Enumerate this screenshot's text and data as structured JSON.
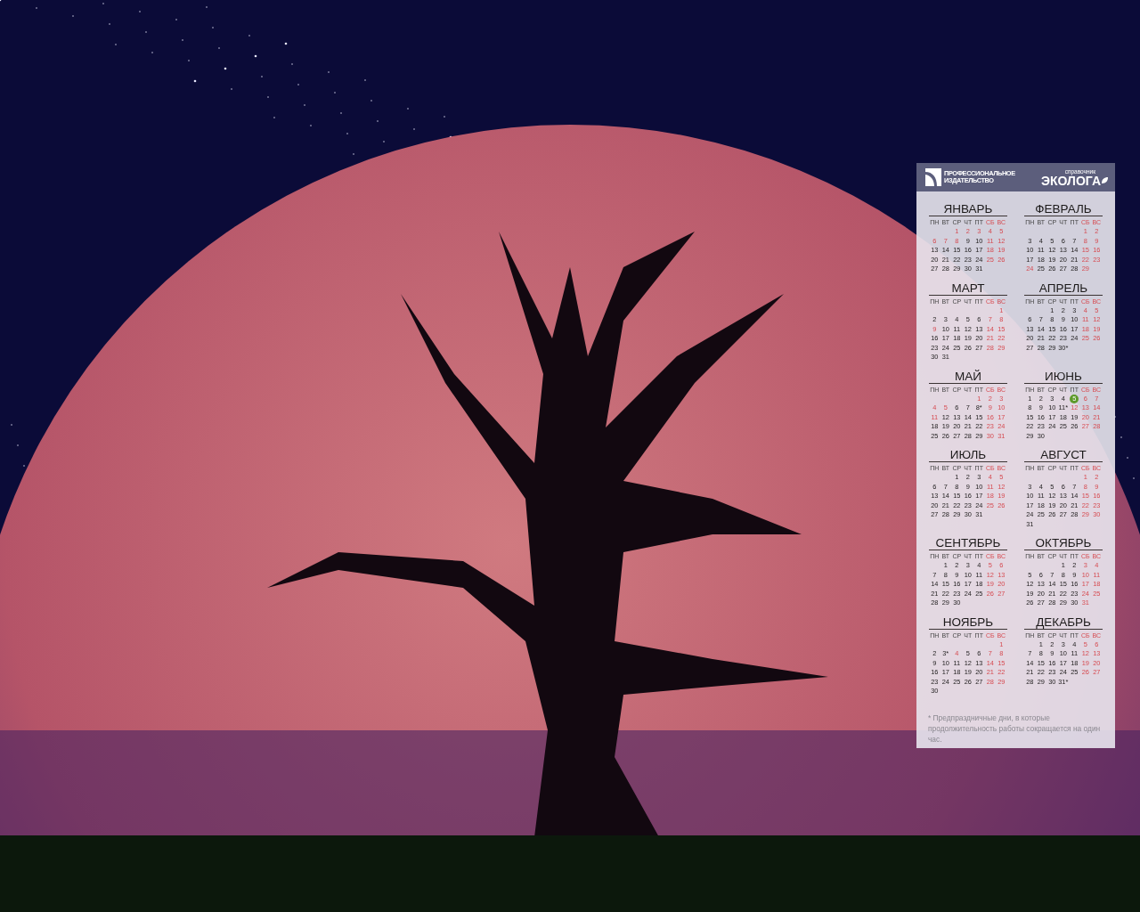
{
  "calendar": {
    "header": {
      "publisher": [
        "ПРОФЕССИОНАЛЬНОЕ",
        "ИЗДАТЕЛЬСТВО"
      ],
      "brand_caption": "справочник",
      "brand": "ЭКОЛОГА"
    },
    "months": [
      {
        "name": "ЯНВАРЬ",
        "weekdays": [
          {
            "t": "ПН",
            "off": false
          },
          {
            "t": "ВТ",
            "off": false
          },
          {
            "t": "СР",
            "off": false
          },
          {
            "t": "ЧТ",
            "off": false
          },
          {
            "t": "ПТ",
            "off": false
          },
          {
            "t": "СБ",
            "off": true
          },
          {
            "t": "ВС",
            "off": true
          }
        ],
        "days": [
          {
            "kind": "blank"
          },
          {
            "kind": "blank"
          },
          {
            "d": "1",
            "kind": "off"
          },
          {
            "d": "2",
            "kind": "off"
          },
          {
            "d": "3",
            "kind": "off"
          },
          {
            "d": "4",
            "kind": "off"
          },
          {
            "d": "5",
            "kind": "off"
          },
          {
            "d": "6",
            "kind": "off"
          },
          {
            "d": "7",
            "kind": "off"
          },
          {
            "d": "8",
            "kind": "off"
          },
          {
            "d": "9",
            "kind": "work"
          },
          {
            "d": "10",
            "kind": "work"
          },
          {
            "d": "11",
            "kind": "off"
          },
          {
            "d": "12",
            "kind": "off"
          },
          {
            "d": "13",
            "kind": "work"
          },
          {
            "d": "14",
            "kind": "work"
          },
          {
            "d": "15",
            "kind": "work"
          },
          {
            "d": "16",
            "kind": "work"
          },
          {
            "d": "17",
            "kind": "work"
          },
          {
            "d": "18",
            "kind": "off"
          },
          {
            "d": "19",
            "kind": "off"
          },
          {
            "d": "20",
            "kind": "work"
          },
          {
            "d": "21",
            "kind": "work"
          },
          {
            "d": "22",
            "kind": "work"
          },
          {
            "d": "23",
            "kind": "work"
          },
          {
            "d": "24",
            "kind": "work"
          },
          {
            "d": "25",
            "kind": "off"
          },
          {
            "d": "26",
            "kind": "off"
          },
          {
            "d": "27",
            "kind": "work"
          },
          {
            "d": "28",
            "kind": "work"
          },
          {
            "d": "29",
            "kind": "work"
          },
          {
            "d": "30",
            "kind": "work"
          },
          {
            "d": "31",
            "kind": "work"
          }
        ]
      },
      {
        "name": "ФЕВРАЛЬ",
        "weekdays": [
          {
            "t": "ПН",
            "off": false
          },
          {
            "t": "ВТ",
            "off": false
          },
          {
            "t": "СР",
            "off": false
          },
          {
            "t": "ЧТ",
            "off": false
          },
          {
            "t": "ПТ",
            "off": false
          },
          {
            "t": "СБ",
            "off": true
          },
          {
            "t": "ВС",
            "off": true
          }
        ],
        "days": [
          {
            "kind": "blank"
          },
          {
            "kind": "blank"
          },
          {
            "kind": "blank"
          },
          {
            "kind": "blank"
          },
          {
            "kind": "blank"
          },
          {
            "d": "1",
            "kind": "off"
          },
          {
            "d": "2",
            "kind": "off"
          },
          {
            "d": "3",
            "kind": "work"
          },
          {
            "d": "4",
            "kind": "work"
          },
          {
            "d": "5",
            "kind": "work"
          },
          {
            "d": "6",
            "kind": "work"
          },
          {
            "d": "7",
            "kind": "work"
          },
          {
            "d": "8",
            "kind": "off"
          },
          {
            "d": "9",
            "kind": "off"
          },
          {
            "d": "10",
            "kind": "work"
          },
          {
            "d": "11",
            "kind": "work"
          },
          {
            "d": "12",
            "kind": "work"
          },
          {
            "d": "13",
            "kind": "work"
          },
          {
            "d": "14",
            "kind": "work"
          },
          {
            "d": "15",
            "kind": "off"
          },
          {
            "d": "16",
            "kind": "off"
          },
          {
            "d": "17",
            "kind": "work"
          },
          {
            "d": "18",
            "kind": "work"
          },
          {
            "d": "19",
            "kind": "work"
          },
          {
            "d": "20",
            "kind": "work"
          },
          {
            "d": "21",
            "kind": "work"
          },
          {
            "d": "22",
            "kind": "off"
          },
          {
            "d": "23",
            "kind": "off"
          },
          {
            "d": "24",
            "kind": "off"
          },
          {
            "d": "25",
            "kind": "work"
          },
          {
            "d": "26",
            "kind": "work"
          },
          {
            "d": "27",
            "kind": "work"
          },
          {
            "d": "28",
            "kind": "work"
          },
          {
            "d": "29",
            "kind": "off"
          }
        ]
      },
      {
        "name": "МАРТ",
        "weekdays": [
          {
            "t": "ПН",
            "off": false
          },
          {
            "t": "ВТ",
            "off": false
          },
          {
            "t": "СР",
            "off": false
          },
          {
            "t": "ЧТ",
            "off": false
          },
          {
            "t": "ПТ",
            "off": false
          },
          {
            "t": "СБ",
            "off": true
          },
          {
            "t": "ВС",
            "off": true
          }
        ],
        "days": [
          {
            "kind": "blank"
          },
          {
            "kind": "blank"
          },
          {
            "kind": "blank"
          },
          {
            "kind": "blank"
          },
          {
            "kind": "blank"
          },
          {
            "kind": "blank"
          },
          {
            "d": "1",
            "kind": "off"
          },
          {
            "d": "2",
            "kind": "work"
          },
          {
            "d": "3",
            "kind": "work"
          },
          {
            "d": "4",
            "kind": "work"
          },
          {
            "d": "5",
            "kind": "work"
          },
          {
            "d": "6",
            "kind": "work"
          },
          {
            "d": "7",
            "kind": "off"
          },
          {
            "d": "8",
            "kind": "off"
          },
          {
            "d": "9",
            "kind": "off"
          },
          {
            "d": "10",
            "kind": "work"
          },
          {
            "d": "11",
            "kind": "work"
          },
          {
            "d": "12",
            "kind": "work"
          },
          {
            "d": "13",
            "kind": "work"
          },
          {
            "d": "14",
            "kind": "off"
          },
          {
            "d": "15",
            "kind": "off"
          },
          {
            "d": "16",
            "kind": "work"
          },
          {
            "d": "17",
            "kind": "work"
          },
          {
            "d": "18",
            "kind": "work"
          },
          {
            "d": "19",
            "kind": "work"
          },
          {
            "d": "20",
            "kind": "work"
          },
          {
            "d": "21",
            "kind": "off"
          },
          {
            "d": "22",
            "kind": "off"
          },
          {
            "d": "23",
            "kind": "work"
          },
          {
            "d": "24",
            "kind": "work"
          },
          {
            "d": "25",
            "kind": "work"
          },
          {
            "d": "26",
            "kind": "work"
          },
          {
            "d": "27",
            "kind": "work"
          },
          {
            "d": "28",
            "kind": "off"
          },
          {
            "d": "29",
            "kind": "off"
          },
          {
            "d": "30",
            "kind": "work"
          },
          {
            "d": "31",
            "kind": "work"
          }
        ]
      },
      {
        "name": "АПРЕЛЬ",
        "weekdays": [
          {
            "t": "ПН",
            "off": false
          },
          {
            "t": "ВТ",
            "off": false
          },
          {
            "t": "СР",
            "off": false
          },
          {
            "t": "ЧТ",
            "off": false
          },
          {
            "t": "ПТ",
            "off": false
          },
          {
            "t": "СБ",
            "off": true
          },
          {
            "t": "ВС",
            "off": true
          }
        ],
        "days": [
          {
            "kind": "blank"
          },
          {
            "kind": "blank"
          },
          {
            "d": "1",
            "kind": "work"
          },
          {
            "d": "2",
            "kind": "work"
          },
          {
            "d": "3",
            "kind": "work"
          },
          {
            "d": "4",
            "kind": "off"
          },
          {
            "d": "5",
            "kind": "off"
          },
          {
            "d": "6",
            "kind": "work"
          },
          {
            "d": "7",
            "kind": "work"
          },
          {
            "d": "8",
            "kind": "work"
          },
          {
            "d": "9",
            "kind": "work"
          },
          {
            "d": "10",
            "kind": "work"
          },
          {
            "d": "11",
            "kind": "off"
          },
          {
            "d": "12",
            "kind": "off"
          },
          {
            "d": "13",
            "kind": "work"
          },
          {
            "d": "14",
            "kind": "work"
          },
          {
            "d": "15",
            "kind": "work"
          },
          {
            "d": "16",
            "kind": "work"
          },
          {
            "d": "17",
            "kind": "work"
          },
          {
            "d": "18",
            "kind": "off"
          },
          {
            "d": "19",
            "kind": "off"
          },
          {
            "d": "20",
            "kind": "work"
          },
          {
            "d": "21",
            "kind": "work"
          },
          {
            "d": "22",
            "kind": "work"
          },
          {
            "d": "23",
            "kind": "work"
          },
          {
            "d": "24",
            "kind": "work"
          },
          {
            "d": "25",
            "kind": "off"
          },
          {
            "d": "26",
            "kind": "off"
          },
          {
            "d": "27",
            "kind": "work"
          },
          {
            "d": "28",
            "kind": "work"
          },
          {
            "d": "29",
            "kind": "work"
          },
          {
            "d": "30*",
            "kind": "work"
          }
        ]
      },
      {
        "name": "МАЙ",
        "weekdays": [
          {
            "t": "ПН",
            "off": false
          },
          {
            "t": "ВТ",
            "off": false
          },
          {
            "t": "СР",
            "off": false
          },
          {
            "t": "ЧТ",
            "off": false
          },
          {
            "t": "ПТ",
            "off": false
          },
          {
            "t": "СБ",
            "off": true
          },
          {
            "t": "ВС",
            "off": true
          }
        ],
        "days": [
          {
            "kind": "blank"
          },
          {
            "kind": "blank"
          },
          {
            "kind": "blank"
          },
          {
            "kind": "blank"
          },
          {
            "d": "1",
            "kind": "off"
          },
          {
            "d": "2",
            "kind": "off"
          },
          {
            "d": "3",
            "kind": "off"
          },
          {
            "d": "4",
            "kind": "off"
          },
          {
            "d": "5",
            "kind": "off"
          },
          {
            "d": "6",
            "kind": "work"
          },
          {
            "d": "7",
            "kind": "work"
          },
          {
            "d": "8*",
            "kind": "work"
          },
          {
            "d": "9",
            "kind": "off"
          },
          {
            "d": "10",
            "kind": "off"
          },
          {
            "d": "11",
            "kind": "off"
          },
          {
            "d": "12",
            "kind": "work"
          },
          {
            "d": "13",
            "kind": "work"
          },
          {
            "d": "14",
            "kind": "work"
          },
          {
            "d": "15",
            "kind": "work"
          },
          {
            "d": "16",
            "kind": "off"
          },
          {
            "d": "17",
            "kind": "off"
          },
          {
            "d": "18",
            "kind": "work"
          },
          {
            "d": "19",
            "kind": "work"
          },
          {
            "d": "20",
            "kind": "work"
          },
          {
            "d": "21",
            "kind": "work"
          },
          {
            "d": "22",
            "kind": "work"
          },
          {
            "d": "23",
            "kind": "off"
          },
          {
            "d": "24",
            "kind": "off"
          },
          {
            "d": "25",
            "kind": "work"
          },
          {
            "d": "26",
            "kind": "work"
          },
          {
            "d": "27",
            "kind": "work"
          },
          {
            "d": "28",
            "kind": "work"
          },
          {
            "d": "29",
            "kind": "work"
          },
          {
            "d": "30",
            "kind": "off"
          },
          {
            "d": "31",
            "kind": "off"
          }
        ]
      },
      {
        "name": "ИЮНЬ",
        "weekdays": [
          {
            "t": "ПН",
            "off": false
          },
          {
            "t": "ВТ",
            "off": false
          },
          {
            "t": "СР",
            "off": false
          },
          {
            "t": "ЧТ",
            "off": false
          },
          {
            "t": "ПТ",
            "off": false
          },
          {
            "t": "СБ",
            "off": true
          },
          {
            "t": "ВС",
            "off": true
          }
        ],
        "days": [
          {
            "d": "1",
            "kind": "work"
          },
          {
            "d": "2",
            "kind": "work"
          },
          {
            "d": "3",
            "kind": "work"
          },
          {
            "d": "4",
            "kind": "work"
          },
          {
            "d": "5",
            "kind": "today"
          },
          {
            "d": "6",
            "kind": "off"
          },
          {
            "d": "7",
            "kind": "off"
          },
          {
            "d": "8",
            "kind": "work"
          },
          {
            "d": "9",
            "kind": "work"
          },
          {
            "d": "10",
            "kind": "work"
          },
          {
            "d": "11*",
            "kind": "work"
          },
          {
            "d": "12",
            "kind": "off"
          },
          {
            "d": "13",
            "kind": "off"
          },
          {
            "d": "14",
            "kind": "off"
          },
          {
            "d": "15",
            "kind": "work"
          },
          {
            "d": "16",
            "kind": "work"
          },
          {
            "d": "17",
            "kind": "work"
          },
          {
            "d": "18",
            "kind": "work"
          },
          {
            "d": "19",
            "kind": "work"
          },
          {
            "d": "20",
            "kind": "off"
          },
          {
            "d": "21",
            "kind": "off"
          },
          {
            "d": "22",
            "kind": "work"
          },
          {
            "d": "23",
            "kind": "work"
          },
          {
            "d": "24",
            "kind": "work"
          },
          {
            "d": "25",
            "kind": "work"
          },
          {
            "d": "26",
            "kind": "work"
          },
          {
            "d": "27",
            "kind": "off"
          },
          {
            "d": "28",
            "kind": "off"
          },
          {
            "d": "29",
            "kind": "work"
          },
          {
            "d": "30",
            "kind": "work"
          }
        ]
      },
      {
        "name": "ИЮЛЬ",
        "weekdays": [
          {
            "t": "ПН",
            "off": false
          },
          {
            "t": "ВТ",
            "off": false
          },
          {
            "t": "СР",
            "off": false
          },
          {
            "t": "ЧТ",
            "off": false
          },
          {
            "t": "ПТ",
            "off": false
          },
          {
            "t": "СБ",
            "off": true
          },
          {
            "t": "ВС",
            "off": true
          }
        ],
        "days": [
          {
            "kind": "blank"
          },
          {
            "kind": "blank"
          },
          {
            "d": "1",
            "kind": "work"
          },
          {
            "d": "2",
            "kind": "work"
          },
          {
            "d": "3",
            "kind": "work"
          },
          {
            "d": "4",
            "kind": "off"
          },
          {
            "d": "5",
            "kind": "off"
          },
          {
            "d": "6",
            "kind": "work"
          },
          {
            "d": "7",
            "kind": "work"
          },
          {
            "d": "8",
            "kind": "work"
          },
          {
            "d": "9",
            "kind": "work"
          },
          {
            "d": "10",
            "kind": "work"
          },
          {
            "d": "11",
            "kind": "off"
          },
          {
            "d": "12",
            "kind": "off"
          },
          {
            "d": "13",
            "kind": "work"
          },
          {
            "d": "14",
            "kind": "work"
          },
          {
            "d": "15",
            "kind": "work"
          },
          {
            "d": "16",
            "kind": "work"
          },
          {
            "d": "17",
            "kind": "work"
          },
          {
            "d": "18",
            "kind": "off"
          },
          {
            "d": "19",
            "kind": "off"
          },
          {
            "d": "20",
            "kind": "work"
          },
          {
            "d": "21",
            "kind": "work"
          },
          {
            "d": "22",
            "kind": "work"
          },
          {
            "d": "23",
            "kind": "work"
          },
          {
            "d": "24",
            "kind": "work"
          },
          {
            "d": "25",
            "kind": "off"
          },
          {
            "d": "26",
            "kind": "off"
          },
          {
            "d": "27",
            "kind": "work"
          },
          {
            "d": "28",
            "kind": "work"
          },
          {
            "d": "29",
            "kind": "work"
          },
          {
            "d": "30",
            "kind": "work"
          },
          {
            "d": "31",
            "kind": "work"
          }
        ]
      },
      {
        "name": "АВГУСТ",
        "weekdays": [
          {
            "t": "ПН",
            "off": false
          },
          {
            "t": "ВТ",
            "off": false
          },
          {
            "t": "СР",
            "off": false
          },
          {
            "t": "ЧТ",
            "off": false
          },
          {
            "t": "ПТ",
            "off": false
          },
          {
            "t": "СБ",
            "off": true
          },
          {
            "t": "ВС",
            "off": true
          }
        ],
        "days": [
          {
            "kind": "blank"
          },
          {
            "kind": "blank"
          },
          {
            "kind": "blank"
          },
          {
            "kind": "blank"
          },
          {
            "kind": "blank"
          },
          {
            "d": "1",
            "kind": "off"
          },
          {
            "d": "2",
            "kind": "off"
          },
          {
            "d": "3",
            "kind": "work"
          },
          {
            "d": "4",
            "kind": "work"
          },
          {
            "d": "5",
            "kind": "work"
          },
          {
            "d": "6",
            "kind": "work"
          },
          {
            "d": "7",
            "kind": "work"
          },
          {
            "d": "8",
            "kind": "off"
          },
          {
            "d": "9",
            "kind": "off"
          },
          {
            "d": "10",
            "kind": "work"
          },
          {
            "d": "11",
            "kind": "work"
          },
          {
            "d": "12",
            "kind": "work"
          },
          {
            "d": "13",
            "kind": "work"
          },
          {
            "d": "14",
            "kind": "work"
          },
          {
            "d": "15",
            "kind": "off"
          },
          {
            "d": "16",
            "kind": "off"
          },
          {
            "d": "17",
            "kind": "work"
          },
          {
            "d": "18",
            "kind": "work"
          },
          {
            "d": "19",
            "kind": "work"
          },
          {
            "d": "20",
            "kind": "work"
          },
          {
            "d": "21",
            "kind": "work"
          },
          {
            "d": "22",
            "kind": "off"
          },
          {
            "d": "23",
            "kind": "off"
          },
          {
            "d": "24",
            "kind": "work"
          },
          {
            "d": "25",
            "kind": "work"
          },
          {
            "d": "26",
            "kind": "work"
          },
          {
            "d": "27",
            "kind": "work"
          },
          {
            "d": "28",
            "kind": "work"
          },
          {
            "d": "29",
            "kind": "off"
          },
          {
            "d": "30",
            "kind": "off"
          },
          {
            "d": "31",
            "kind": "work"
          }
        ]
      },
      {
        "name": "СЕНТЯБРЬ",
        "weekdays": [
          {
            "t": "ПН",
            "off": false
          },
          {
            "t": "ВТ",
            "off": false
          },
          {
            "t": "СР",
            "off": false
          },
          {
            "t": "ЧТ",
            "off": false
          },
          {
            "t": "ПТ",
            "off": false
          },
          {
            "t": "СБ",
            "off": true
          },
          {
            "t": "ВС",
            "off": true
          }
        ],
        "days": [
          {
            "kind": "blank"
          },
          {
            "d": "1",
            "kind": "work"
          },
          {
            "d": "2",
            "kind": "work"
          },
          {
            "d": "3",
            "kind": "work"
          },
          {
            "d": "4",
            "kind": "work"
          },
          {
            "d": "5",
            "kind": "off"
          },
          {
            "d": "6",
            "kind": "off"
          },
          {
            "d": "7",
            "kind": "work"
          },
          {
            "d": "8",
            "kind": "work"
          },
          {
            "d": "9",
            "kind": "work"
          },
          {
            "d": "10",
            "kind": "work"
          },
          {
            "d": "11",
            "kind": "work"
          },
          {
            "d": "12",
            "kind": "off"
          },
          {
            "d": "13",
            "kind": "off"
          },
          {
            "d": "14",
            "kind": "work"
          },
          {
            "d": "15",
            "kind": "work"
          },
          {
            "d": "16",
            "kind": "work"
          },
          {
            "d": "17",
            "kind": "work"
          },
          {
            "d": "18",
            "kind": "work"
          },
          {
            "d": "19",
            "kind": "off"
          },
          {
            "d": "20",
            "kind": "off"
          },
          {
            "d": "21",
            "kind": "work"
          },
          {
            "d": "22",
            "kind": "work"
          },
          {
            "d": "23",
            "kind": "work"
          },
          {
            "d": "24",
            "kind": "work"
          },
          {
            "d": "25",
            "kind": "work"
          },
          {
            "d": "26",
            "kind": "off"
          },
          {
            "d": "27",
            "kind": "off"
          },
          {
            "d": "28",
            "kind": "work"
          },
          {
            "d": "29",
            "kind": "work"
          },
          {
            "d": "30",
            "kind": "work"
          }
        ]
      },
      {
        "name": "ОКТЯБРЬ",
        "weekdays": [
          {
            "t": "ПН",
            "off": false
          },
          {
            "t": "ВТ",
            "off": false
          },
          {
            "t": "СР",
            "off": false
          },
          {
            "t": "ЧТ",
            "off": false
          },
          {
            "t": "ПТ",
            "off": false
          },
          {
            "t": "СБ",
            "off": true
          },
          {
            "t": "ВС",
            "off": true
          }
        ],
        "days": [
          {
            "kind": "blank"
          },
          {
            "kind": "blank"
          },
          {
            "kind": "blank"
          },
          {
            "d": "1",
            "kind": "work"
          },
          {
            "d": "2",
            "kind": "work"
          },
          {
            "d": "3",
            "kind": "off"
          },
          {
            "d": "4",
            "kind": "off"
          },
          {
            "d": "5",
            "kind": "work"
          },
          {
            "d": "6",
            "kind": "work"
          },
          {
            "d": "7",
            "kind": "work"
          },
          {
            "d": "8",
            "kind": "work"
          },
          {
            "d": "9",
            "kind": "work"
          },
          {
            "d": "10",
            "kind": "off"
          },
          {
            "d": "11",
            "kind": "off"
          },
          {
            "d": "12",
            "kind": "work"
          },
          {
            "d": "13",
            "kind": "work"
          },
          {
            "d": "14",
            "kind": "work"
          },
          {
            "d": "15",
            "kind": "work"
          },
          {
            "d": "16",
            "kind": "work"
          },
          {
            "d": "17",
            "kind": "off"
          },
          {
            "d": "18",
            "kind": "off"
          },
          {
            "d": "19",
            "kind": "work"
          },
          {
            "d": "20",
            "kind": "work"
          },
          {
            "d": "21",
            "kind": "work"
          },
          {
            "d": "22",
            "kind": "work"
          },
          {
            "d": "23",
            "kind": "work"
          },
          {
            "d": "24",
            "kind": "off"
          },
          {
            "d": "25",
            "kind": "off"
          },
          {
            "d": "26",
            "kind": "work"
          },
          {
            "d": "27",
            "kind": "work"
          },
          {
            "d": "28",
            "kind": "work"
          },
          {
            "d": "29",
            "kind": "work"
          },
          {
            "d": "30",
            "kind": "work"
          },
          {
            "d": "31",
            "kind": "off"
          }
        ]
      },
      {
        "name": "НОЯБРЬ",
        "weekdays": [
          {
            "t": "ПН",
            "off": false
          },
          {
            "t": "ВТ",
            "off": false
          },
          {
            "t": "СР",
            "off": false
          },
          {
            "t": "ЧТ",
            "off": false
          },
          {
            "t": "ПТ",
            "off": false
          },
          {
            "t": "СБ",
            "off": true
          },
          {
            "t": "ВС",
            "off": true
          }
        ],
        "days": [
          {
            "kind": "blank"
          },
          {
            "kind": "blank"
          },
          {
            "kind": "blank"
          },
          {
            "kind": "blank"
          },
          {
            "kind": "blank"
          },
          {
            "kind": "blank"
          },
          {
            "d": "1",
            "kind": "off"
          },
          {
            "d": "2",
            "kind": "work"
          },
          {
            "d": "3*",
            "kind": "work"
          },
          {
            "d": "4",
            "kind": "off"
          },
          {
            "d": "5",
            "kind": "work"
          },
          {
            "d": "6",
            "kind": "work"
          },
          {
            "d": "7",
            "kind": "off"
          },
          {
            "d": "8",
            "kind": "off"
          },
          {
            "d": "9",
            "kind": "work"
          },
          {
            "d": "10",
            "kind": "work"
          },
          {
            "d": "11",
            "kind": "work"
          },
          {
            "d": "12",
            "kind": "work"
          },
          {
            "d": "13",
            "kind": "work"
          },
          {
            "d": "14",
            "kind": "off"
          },
          {
            "d": "15",
            "kind": "off"
          },
          {
            "d": "16",
            "kind": "work"
          },
          {
            "d": "17",
            "kind": "work"
          },
          {
            "d": "18",
            "kind": "work"
          },
          {
            "d": "19",
            "kind": "work"
          },
          {
            "d": "20",
            "kind": "work"
          },
          {
            "d": "21",
            "kind": "off"
          },
          {
            "d": "22",
            "kind": "off"
          },
          {
            "d": "23",
            "kind": "work"
          },
          {
            "d": "24",
            "kind": "work"
          },
          {
            "d": "25",
            "kind": "work"
          },
          {
            "d": "26",
            "kind": "work"
          },
          {
            "d": "27",
            "kind": "work"
          },
          {
            "d": "28",
            "kind": "off"
          },
          {
            "d": "29",
            "kind": "off"
          },
          {
            "d": "30",
            "kind": "work"
          }
        ]
      },
      {
        "name": "ДЕКАБРЬ",
        "weekdays": [
          {
            "t": "ПН",
            "off": false
          },
          {
            "t": "ВТ",
            "off": false
          },
          {
            "t": "СР",
            "off": false
          },
          {
            "t": "ЧТ",
            "off": false
          },
          {
            "t": "ПТ",
            "off": false
          },
          {
            "t": "СБ",
            "off": true
          },
          {
            "t": "ВС",
            "off": true
          }
        ],
        "days": [
          {
            "kind": "blank"
          },
          {
            "d": "1",
            "kind": "work"
          },
          {
            "d": "2",
            "kind": "work"
          },
          {
            "d": "3",
            "kind": "work"
          },
          {
            "d": "4",
            "kind": "work"
          },
          {
            "d": "5",
            "kind": "off"
          },
          {
            "d": "6",
            "kind": "off"
          },
          {
            "d": "7",
            "kind": "work"
          },
          {
            "d": "8",
            "kind": "work"
          },
          {
            "d": "9",
            "kind": "work"
          },
          {
            "d": "10",
            "kind": "work"
          },
          {
            "d": "11",
            "kind": "work"
          },
          {
            "d": "12",
            "kind": "off"
          },
          {
            "d": "13",
            "kind": "off"
          },
          {
            "d": "14",
            "kind": "work"
          },
          {
            "d": "15",
            "kind": "work"
          },
          {
            "d": "16",
            "kind": "work"
          },
          {
            "d": "17",
            "kind": "work"
          },
          {
            "d": "18",
            "kind": "work"
          },
          {
            "d": "19",
            "kind": "off"
          },
          {
            "d": "20",
            "kind": "off"
          },
          {
            "d": "21",
            "kind": "work"
          },
          {
            "d": "22",
            "kind": "work"
          },
          {
            "d": "23",
            "kind": "work"
          },
          {
            "d": "24",
            "kind": "work"
          },
          {
            "d": "25",
            "kind": "work"
          },
          {
            "d": "26",
            "kind": "off"
          },
          {
            "d": "27",
            "kind": "off"
          },
          {
            "d": "28",
            "kind": "work"
          },
          {
            "d": "29",
            "kind": "work"
          },
          {
            "d": "30",
            "kind": "work"
          },
          {
            "d": "31*",
            "kind": "work"
          }
        ]
      }
    ],
    "footnote": "* Предпраздничные дни, в которые продолжительность работы сокращается на один час."
  }
}
